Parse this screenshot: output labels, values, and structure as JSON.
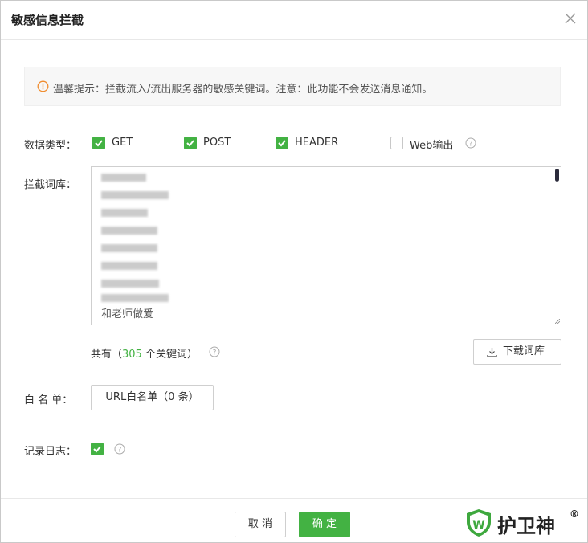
{
  "dialog": {
    "title": "敏感信息拦截",
    "close_icon": "close-icon"
  },
  "tip": {
    "icon": "info-circle-icon",
    "text": "温馨提示：拦截流入/流出服务器的敏感关键词。注意：此功能不会发送消息通知。"
  },
  "data_type": {
    "label": "数据类型：",
    "options": [
      {
        "label": "GET",
        "checked": true
      },
      {
        "label": "POST",
        "checked": true
      },
      {
        "label": "HEADER",
        "checked": true
      },
      {
        "label": "Web输出",
        "checked": false
      }
    ]
  },
  "lexicon": {
    "label": "拦截词库：",
    "last_visible_line": "和老师做爱",
    "count_prefix": "共有（",
    "count_value": "305",
    "count_suffix": " 个关键词）",
    "download_label": "下载词库"
  },
  "whitelist": {
    "label": "白 名 单：",
    "button_label": "URL白名单（0 条）"
  },
  "log": {
    "label": "记录日志：",
    "checked": true
  },
  "footer": {
    "cancel_label": "取 消",
    "confirm_label": "确 定"
  },
  "brand": {
    "name": "护卫神",
    "reg_mark": "®",
    "logo_letter": "W"
  },
  "colors": {
    "accent": "#43b243",
    "warning": "#f08c2e"
  }
}
